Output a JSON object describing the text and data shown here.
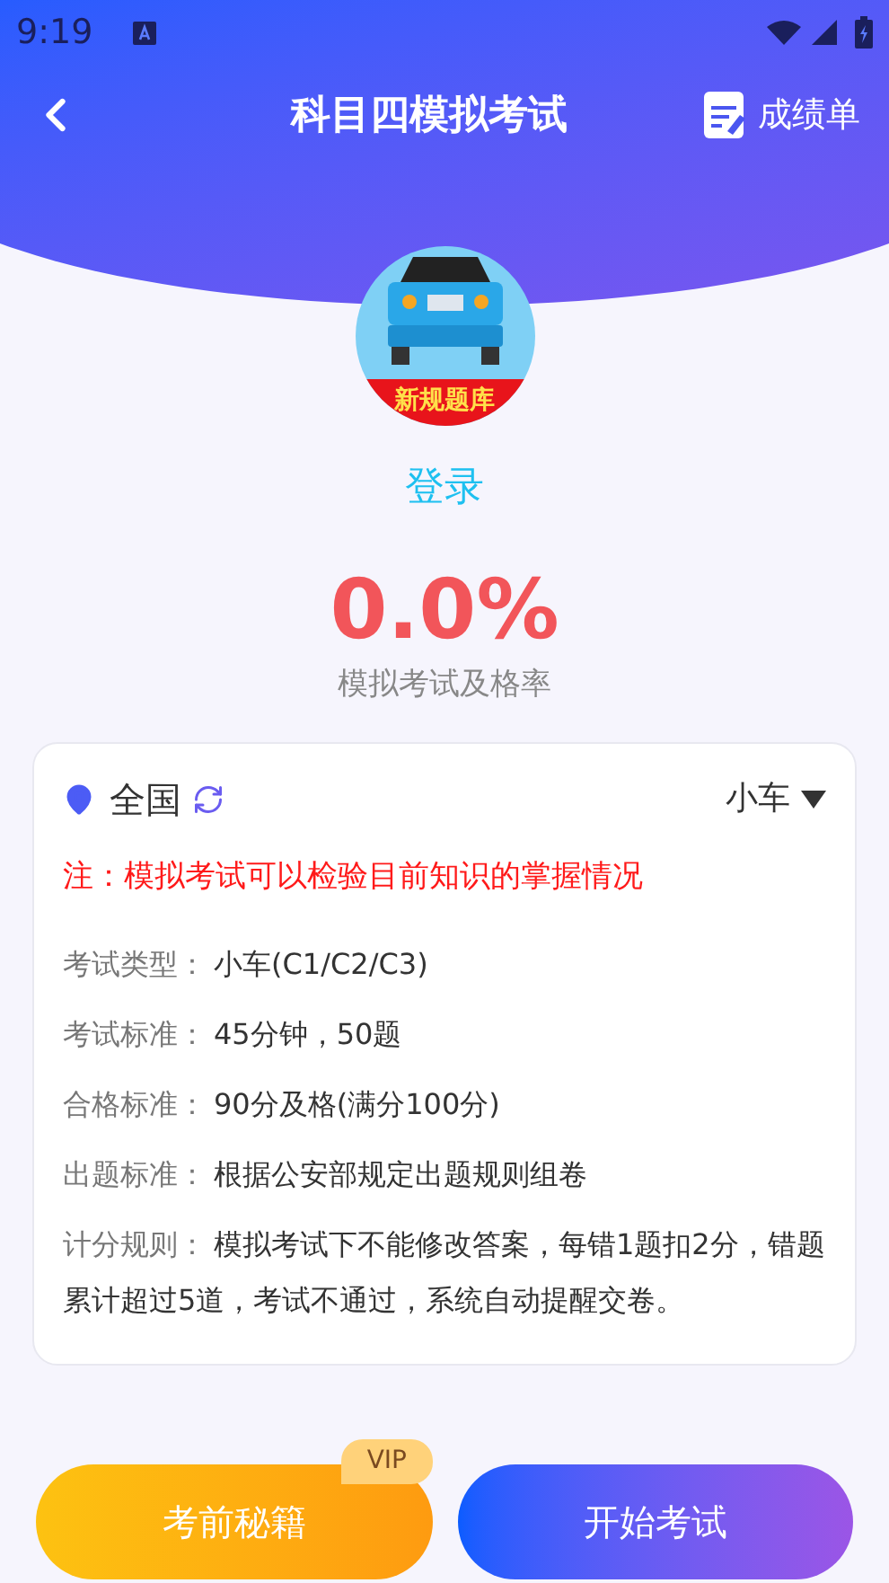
{
  "status_bar": {
    "time": "9:19"
  },
  "header": {
    "title": "科目四模拟考试",
    "action": "成绩单"
  },
  "profile": {
    "badge": "新规题库",
    "login": "登录"
  },
  "stats": {
    "rate": "0.0%",
    "caption": "模拟考试及格率"
  },
  "card": {
    "region": "全国",
    "vehicle": "小车",
    "notice": "注：模拟考试可以检验目前知识的掌握情况",
    "rows": [
      {
        "label": "考试类型：",
        "value": "小车(C1/C2/C3)"
      },
      {
        "label": "考试标准：",
        "value": "45分钟，50题"
      },
      {
        "label": "合格标准：",
        "value": "90分及格(满分100分)"
      },
      {
        "label": "出题标准：",
        "value": "根据公安部规定出题规则组卷"
      },
      {
        "label": "计分规则：",
        "value": "模拟考试下不能修改答案，每错1题扣2分，错题累计超过5道，考试不通过，系统自动提醒交卷。"
      }
    ]
  },
  "buttons": [
    {
      "label": "考前秘籍",
      "badge": "VIP",
      "kind": "secondary"
    },
    {
      "label": "开始考试",
      "kind": "primary"
    }
  ]
}
